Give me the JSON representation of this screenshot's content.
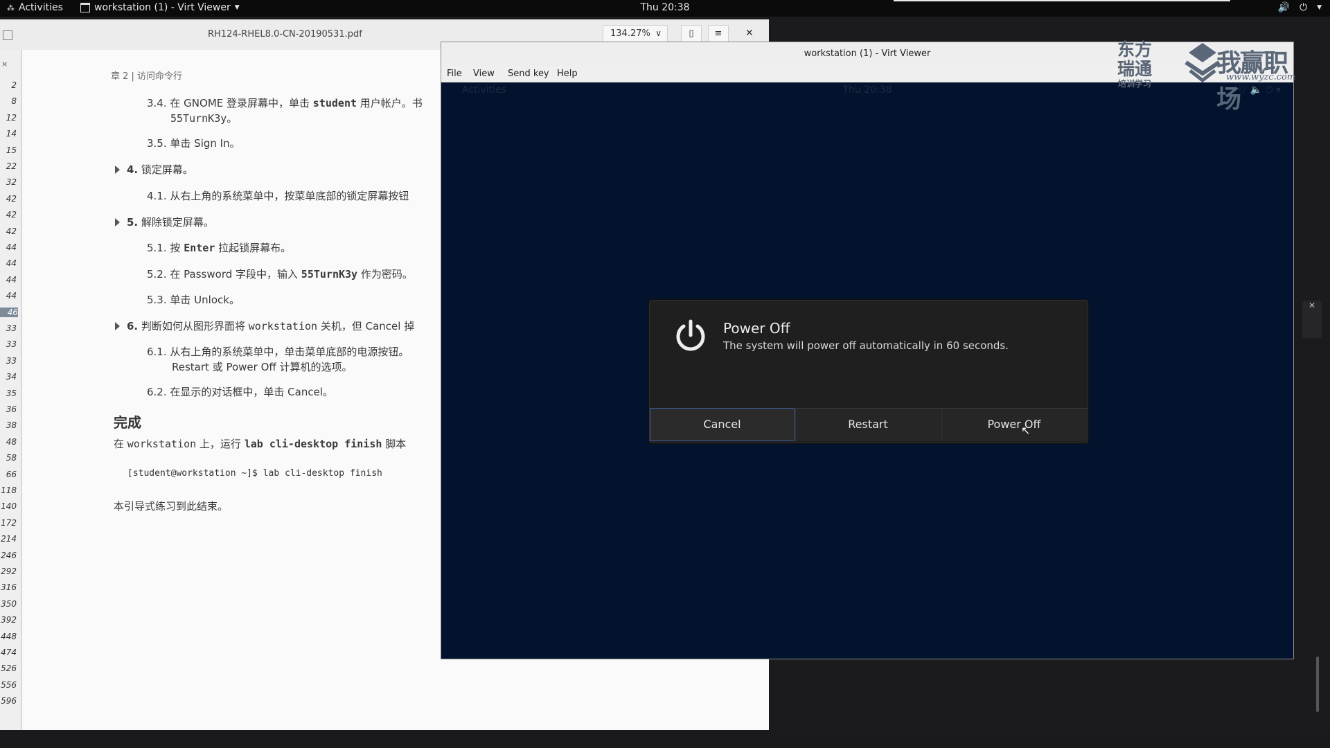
{
  "topbar": {
    "activities": "Activities",
    "app_name": "workstation (1) - Virt Viewer",
    "clock": "Thu 20:38"
  },
  "pdf": {
    "filename": "RH124-RHEL8.0-CN-20190531.pdf",
    "zoom": "134.27%",
    "page_numbers": [
      "2",
      "8",
      "12",
      "14",
      "15",
      "22",
      "32",
      "42",
      "42",
      "42",
      "44",
      "44",
      "44",
      "44",
      "46",
      "33",
      "33",
      "33",
      "34",
      "35",
      "36",
      "38",
      "48",
      "58",
      "66",
      "118",
      "140",
      "172",
      "214",
      "246",
      "292",
      "316",
      "350",
      "392",
      "448",
      "474",
      "526",
      "556",
      "596"
    ],
    "selected_page": "46",
    "chapter": "章 2 | 访问命令行",
    "lines": {
      "s34_num": "3.4.",
      "s34_a": "在 GNOME 登录屏幕中，单击",
      "s34_b": "student",
      "s34_c": "用户帐户。书",
      "s34_pw": "55TurnK3y。",
      "s35_num": "3.5.",
      "s35": "单击 Sign In。",
      "s4_num": "4.",
      "s4": "锁定屏幕。",
      "s41_num": "4.1.",
      "s41": "从右上角的系统菜单中，按菜单底部的锁定屏幕按钮",
      "s5_num": "5.",
      "s5": "解除锁定屏幕。",
      "s51_num": "5.1.",
      "s51_a": "按",
      "s51_b": "Enter",
      "s51_c": "拉起锁屏幕布。",
      "s52_num": "5.2.",
      "s52_a": "在 Password 字段中，输入",
      "s52_b": "55TurnK3y",
      "s52_c": "作为密码。",
      "s53_num": "5.3.",
      "s53": "单击 Unlock。",
      "s6_num": "6.",
      "s6_a": "判断如何从图形界面将",
      "s6_b": "workstation",
      "s6_c": "关机，但 Cancel 掉",
      "s61_num": "6.1.",
      "s61_a": "从右上角的系统菜单中，单击菜单底部的电源按钮。",
      "s61_b": "Restart 或 Power Off 计算机的选项。",
      "s62_num": "6.2.",
      "s62": "在显示的对话框中，单击 Cancel。",
      "done_heading": "完成",
      "done_a": "在",
      "done_b": "workstation",
      "done_c": "上，运行",
      "done_d": "lab cli-desktop finish",
      "done_e": "脚本",
      "cmd": "[student@workstation ~]$ lab cli-desktop finish",
      "end": "本引导式练习到此结束。"
    }
  },
  "virt_viewer": {
    "title": "workstation (1) - Virt Viewer",
    "menu": [
      "File",
      "View",
      "Send key",
      "Help"
    ],
    "guest_activities": "Activities",
    "guest_clock": "Thu 20:38"
  },
  "dialog": {
    "title": "Power Off",
    "message": "The system will power off automatically in 60 seconds.",
    "buttons": [
      "Cancel",
      "Restart",
      "Power Off"
    ]
  },
  "watermark": {
    "left_lines": [
      "东方",
      "瑞通",
      "培训学习"
    ],
    "right_big": "我赢职场",
    "right_url": "www.wyzc.com"
  }
}
